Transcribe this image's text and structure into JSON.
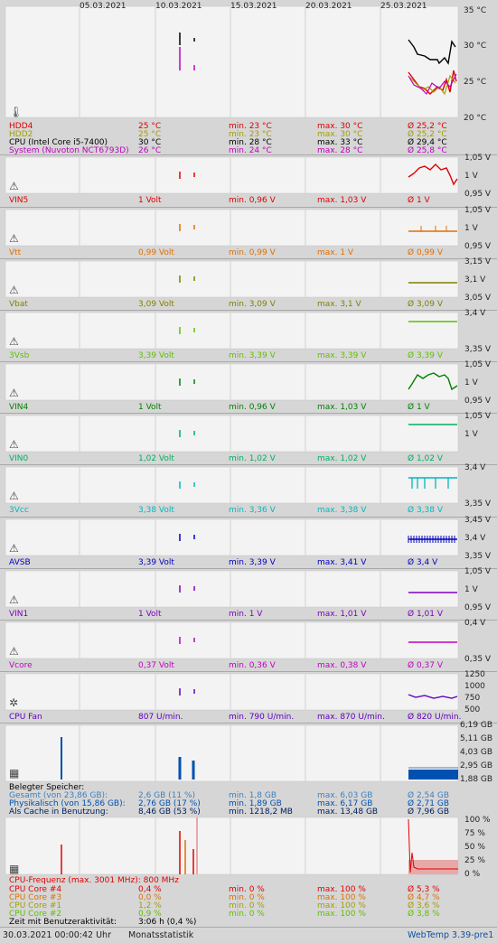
{
  "dates": [
    "05.03.2021",
    "10.03.2021",
    "15.03.2021",
    "20.03.2021",
    "25.03.2021"
  ],
  "temp": {
    "axis": [
      "35 °C",
      "30 °C",
      "25 °C",
      "20 °C"
    ],
    "rows": [
      {
        "name": "HDD4",
        "cur": "25 °C",
        "min": "min. 23 °C",
        "max": "max. 30 °C",
        "avg": "Ø 25,2 °C",
        "color": "#e00000"
      },
      {
        "name": "HDD2",
        "cur": "25 °C",
        "min": "min. 23 °C",
        "max": "max. 30 °C",
        "avg": "Ø 25,2 °C",
        "color": "#a0a000"
      },
      {
        "name": "CPU (Intel Core i5-7400)",
        "cur": "30 °C",
        "min": "min. 28 °C",
        "max": "max. 33 °C",
        "avg": "Ø 29,4 °C",
        "color": "#000000"
      },
      {
        "name": "System (Nuvoton NCT6793D)",
        "cur": "26 °C",
        "min": "min. 24 °C",
        "max": "max. 28 °C",
        "avg": "Ø 25,8 °C",
        "color": "#c000c0"
      }
    ]
  },
  "sensors": [
    {
      "name": "VIN5",
      "cur": "1 Volt",
      "min": "min. 0,96 V",
      "max": "max. 1,03 V",
      "avg": "Ø 1 V",
      "color": "#e00000",
      "axis": [
        "1,05 V",
        "1 V",
        "0,95 V"
      ]
    },
    {
      "name": "Vtt",
      "cur": "0,99 Volt",
      "min": "min. 0,99 V",
      "max": "max. 1 V",
      "avg": "Ø 0,99 V",
      "color": "#e07000",
      "axis": [
        "1,05 V",
        "1 V",
        "0,95 V"
      ]
    },
    {
      "name": "Vbat",
      "cur": "3,09 Volt",
      "min": "min. 3,09 V",
      "max": "max. 3,1 V",
      "avg": "Ø 3,09 V",
      "color": "#808000",
      "axis": [
        "3,15 V",
        "3,1 V",
        "3,05 V"
      ]
    },
    {
      "name": "3Vsb",
      "cur": "3,39 Volt",
      "min": "min. 3,39 V",
      "max": "max. 3,39 V",
      "avg": "Ø 3,39 V",
      "color": "#60c000",
      "axis": [
        "3,4 V",
        "",
        "3,35 V"
      ]
    },
    {
      "name": "VIN4",
      "cur": "1 Volt",
      "min": "min. 0,96 V",
      "max": "max. 1,03 V",
      "avg": "Ø 1 V",
      "color": "#008000",
      "axis": [
        "1,05 V",
        "1 V",
        "0,95 V"
      ]
    },
    {
      "name": "VIN0",
      "cur": "1,02 Volt",
      "min": "min. 1,02 V",
      "max": "max. 1,02 V",
      "avg": "Ø 1,02 V",
      "color": "#00b060",
      "axis": [
        "1,05 V",
        "1 V",
        ""
      ]
    },
    {
      "name": "3Vcc",
      "cur": "3,38 Volt",
      "min": "min. 3,36 V",
      "max": "max. 3,38 V",
      "avg": "Ø 3,38 V",
      "color": "#00b8c0",
      "axis": [
        "3,4 V",
        "",
        "3,35 V"
      ]
    },
    {
      "name": "AVSB",
      "cur": "3,39 Volt",
      "min": "min. 3,39 V",
      "max": "max. 3,41 V",
      "avg": "Ø 3,4 V",
      "color": "#0000c0",
      "axis": [
        "3,45 V",
        "3,4 V",
        "3,35 V"
      ]
    },
    {
      "name": "VIN1",
      "cur": "1 Volt",
      "min": "min. 1 V",
      "max": "max. 1,01 V",
      "avg": "Ø 1,01 V",
      "color": "#8000c0",
      "axis": [
        "1,05 V",
        "1 V",
        "0,95 V"
      ]
    },
    {
      "name": "Vcore",
      "cur": "0,37 Volt",
      "min": "min. 0,36 V",
      "max": "max. 0,38 V",
      "avg": "Ø 0,37 V",
      "color": "#c000c0",
      "axis": [
        "0,4 V",
        "",
        "0,35 V"
      ]
    },
    {
      "name": "CPU Fan",
      "cur": "807 U/min.",
      "min": "min. 790 U/min.",
      "max": "max. 870 U/min.",
      "avg": "Ø 820 U/min.",
      "color": "#6000c0",
      "axis": [
        "1250",
        "1000",
        "750",
        "500"
      ]
    }
  ],
  "memory": {
    "axis": [
      "6,19 GB",
      "5,11 GB",
      "4,03 GB",
      "2,95 GB",
      "1,88 GB"
    ],
    "title": "Belegter Speicher:",
    "rows": [
      {
        "name": "Gesamt (von 23,86 GB):",
        "cur": "2,6 GB (11 %)",
        "min": "min. 1,8 GB",
        "max": "max. 6,03 GB",
        "avg": "Ø 2,54 GB",
        "color": "#4080c0"
      },
      {
        "name": "Physikalisch (von 15,86 GB):",
        "cur": "2,76 GB (17 %)",
        "min": "min. 1,89 GB",
        "max": "max. 6,17 GB",
        "avg": "Ø 2,71 GB",
        "color": "#0050b0"
      },
      {
        "name": "Als Cache in Benutzung:",
        "cur": "8,46 GB (53 %)",
        "min": "min. 1218,2 MB",
        "max": "max. 13,48 GB",
        "avg": "Ø 7,96 GB",
        "color": "#002060"
      }
    ]
  },
  "cpu": {
    "axis": [
      "100 %",
      "75 %",
      "50 %",
      "25 %",
      "0 %"
    ],
    "freq": "CPU-Frequenz (max. 3001 MHz): 800 MHz",
    "rows": [
      {
        "name": "CPU Core #4",
        "cur": "0,4 %",
        "min": "min. 0 %",
        "max": "max. 100 %",
        "avg": "Ø 5,3 %",
        "color": "#e00000"
      },
      {
        "name": "CPU Core #3",
        "cur": "0,0 %",
        "min": "min. 0 %",
        "max": "max. 100 %",
        "avg": "Ø 4,7 %",
        "color": "#e07000"
      },
      {
        "name": "CPU Core #1",
        "cur": "1,2 %",
        "min": "min. 0 %",
        "max": "max. 100 %",
        "avg": "Ø 3,6 %",
        "color": "#a0a000"
      },
      {
        "name": "CPU Core #2",
        "cur": "0,9 %",
        "min": "min. 0 %",
        "max": "max. 100 %",
        "avg": "Ø 3,8 %",
        "color": "#60c000"
      }
    ],
    "useractivity_label": "Zeit mit Benutzeraktivität:",
    "useractivity_value": "3:06 h (0,4 %)"
  },
  "footer": {
    "timestamp": "30.03.2021 00:00:42 Uhr",
    "link": "Monatsstatistik",
    "version": "WebTemp 3.39-pre1"
  }
}
